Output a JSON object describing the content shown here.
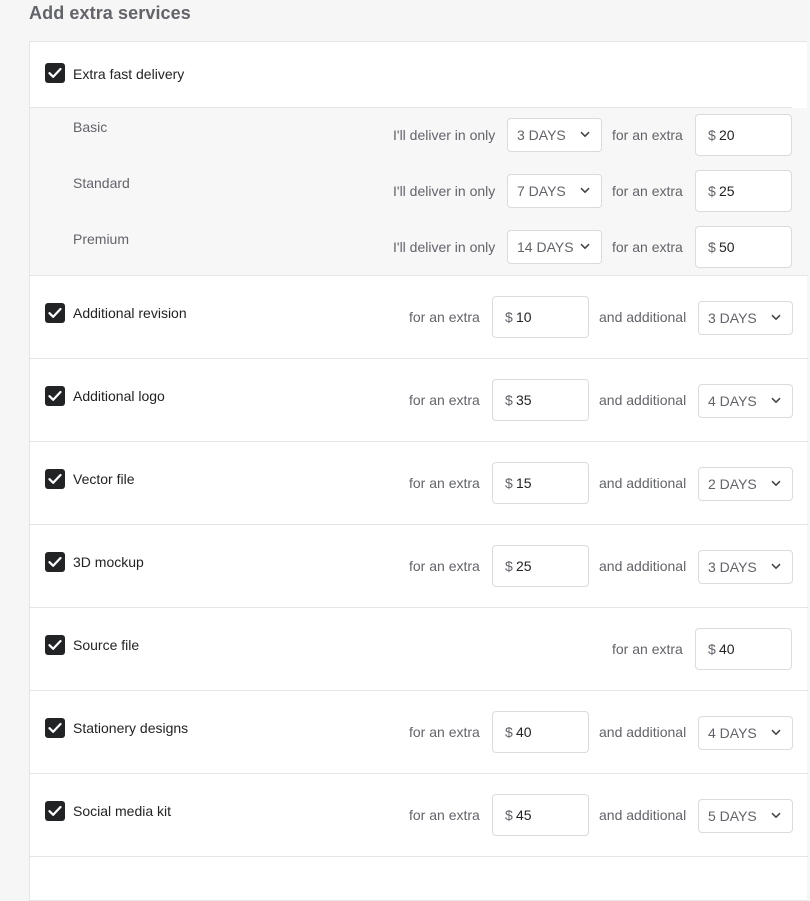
{
  "page": {
    "title": "Add extra services"
  },
  "colors": {
    "checkbox": "#222325",
    "border": "#dadbdd",
    "panel_bg": "#f7f7f7"
  },
  "fast_delivery": {
    "label": "Extra fast delivery",
    "checked": true,
    "tiers": [
      {
        "name": "Basic",
        "prefix": "I'll deliver in only",
        "days": "3 DAYS",
        "extra_label": "for an extra",
        "currency": "$",
        "price": "20"
      },
      {
        "name": "Standard",
        "prefix": "I'll deliver in only",
        "days": "7 DAYS",
        "extra_label": "for an extra",
        "currency": "$",
        "price": "25"
      },
      {
        "name": "Premium",
        "prefix": "I'll deliver in only",
        "days": "14 DAYS",
        "extra_label": "for an extra",
        "currency": "$",
        "price": "50"
      }
    ]
  },
  "services": [
    {
      "label": "Additional revision",
      "checked": true,
      "extra_label": "for an extra",
      "currency": "$",
      "price": "10",
      "additional_label": "and additional",
      "days": "3 DAYS"
    },
    {
      "label": "Additional logo",
      "checked": true,
      "extra_label": "for an extra",
      "currency": "$",
      "price": "35",
      "additional_label": "and additional",
      "days": "4 DAYS"
    },
    {
      "label": "Vector file",
      "checked": true,
      "extra_label": "for an extra",
      "currency": "$",
      "price": "15",
      "additional_label": "and additional",
      "days": "2 DAYS"
    },
    {
      "label": "3D mockup",
      "checked": true,
      "extra_label": "for an extra",
      "currency": "$",
      "price": "25",
      "additional_label": "and additional",
      "days": "3 DAYS"
    },
    {
      "label": "Source file",
      "checked": true,
      "extra_label": "for an extra",
      "currency": "$",
      "price": "40"
    },
    {
      "label": "Stationery designs",
      "checked": true,
      "extra_label": "for an extra",
      "currency": "$",
      "price": "40",
      "additional_label": "and additional",
      "days": "4 DAYS"
    },
    {
      "label": "Social media kit",
      "checked": true,
      "extra_label": "for an extra",
      "currency": "$",
      "price": "45",
      "additional_label": "and additional",
      "days": "5 DAYS"
    }
  ]
}
